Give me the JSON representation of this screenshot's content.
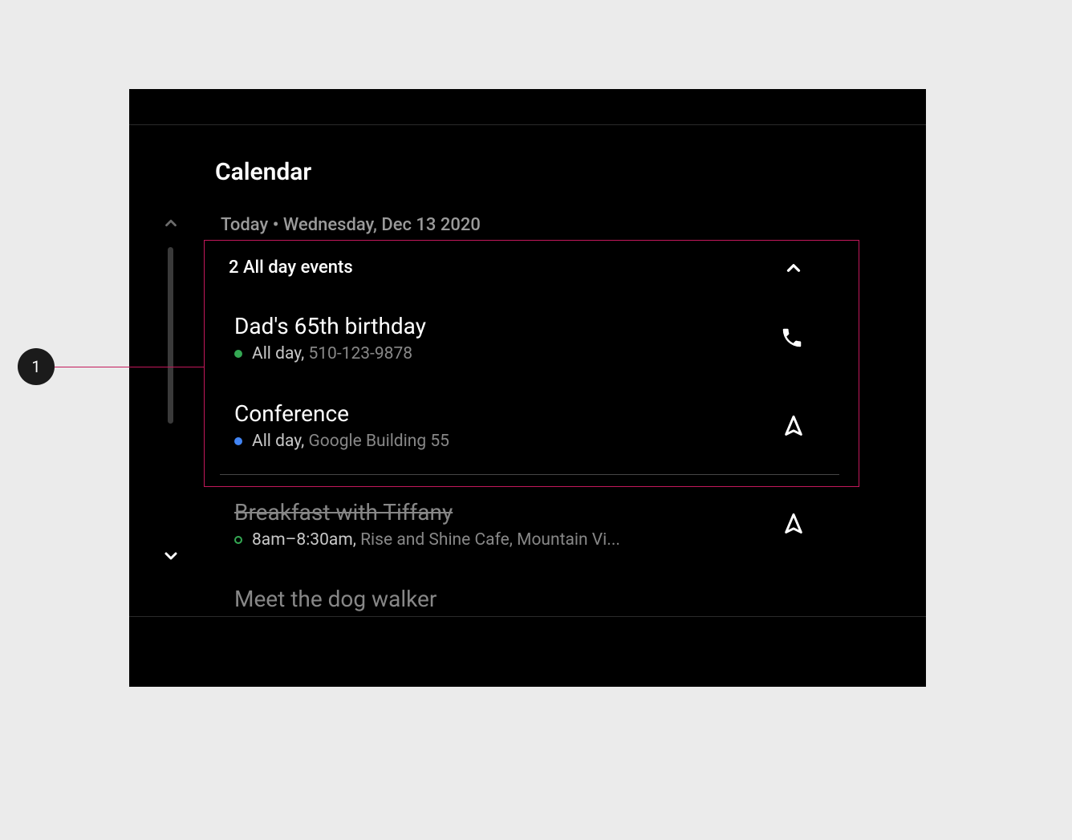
{
  "header": {
    "title": "Calendar",
    "date_line": "Today • Wednesday, Dec 13 2020"
  },
  "allday_section": {
    "label": "2 All day events"
  },
  "events": {
    "e1": {
      "title": "Dad's 65th birthday",
      "time": "All day,",
      "detail": "510-123-9878"
    },
    "e2": {
      "title": "Conference",
      "time": "All day,",
      "detail": "Google Building 55"
    },
    "e3": {
      "title": "Breakfast with Tiffany",
      "time": "8am–8:30am,",
      "detail": "Rise and Shine Cafe, Mountain Vi..."
    },
    "e4": {
      "title": "Meet the dog walker"
    }
  },
  "callout": {
    "num": "1"
  }
}
